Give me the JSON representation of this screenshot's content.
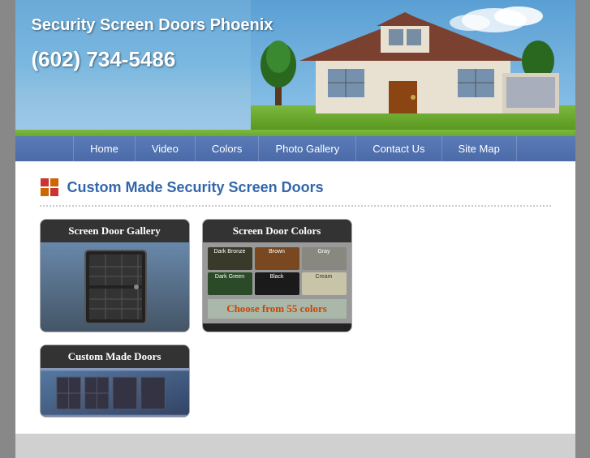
{
  "site": {
    "title": "Security Screen Doors Phoenix",
    "phone": "(602) 734-5486"
  },
  "nav": {
    "items": [
      {
        "label": "Home",
        "id": "home"
      },
      {
        "label": "Video",
        "id": "video"
      },
      {
        "label": "Colors",
        "id": "colors"
      },
      {
        "label": "Photo Gallery",
        "id": "photo-gallery"
      },
      {
        "label": "Contact Us",
        "id": "contact-us"
      },
      {
        "label": "Site Map",
        "id": "site-map"
      }
    ]
  },
  "main": {
    "section_title": "Custom Made Security Screen Doors",
    "card_gallery_title": "Screen Door Gallery",
    "card_colors_title": "Screen Door Colors",
    "card_colors_cta": "Choose from 55 colors",
    "card_custom_title": "Custom Made Doors",
    "swatches": [
      {
        "color": "#3a3a2a",
        "label": "Dark Bronze"
      },
      {
        "color": "#8b4513",
        "label": "Brown"
      },
      {
        "color": "#888880",
        "label": "Gray"
      },
      {
        "color": "#2a4a2a",
        "label": "Dark Green"
      },
      {
        "color": "#1a1a1a",
        "label": "Black"
      },
      {
        "color": "#c8c8b0",
        "label": "Cream"
      }
    ]
  }
}
